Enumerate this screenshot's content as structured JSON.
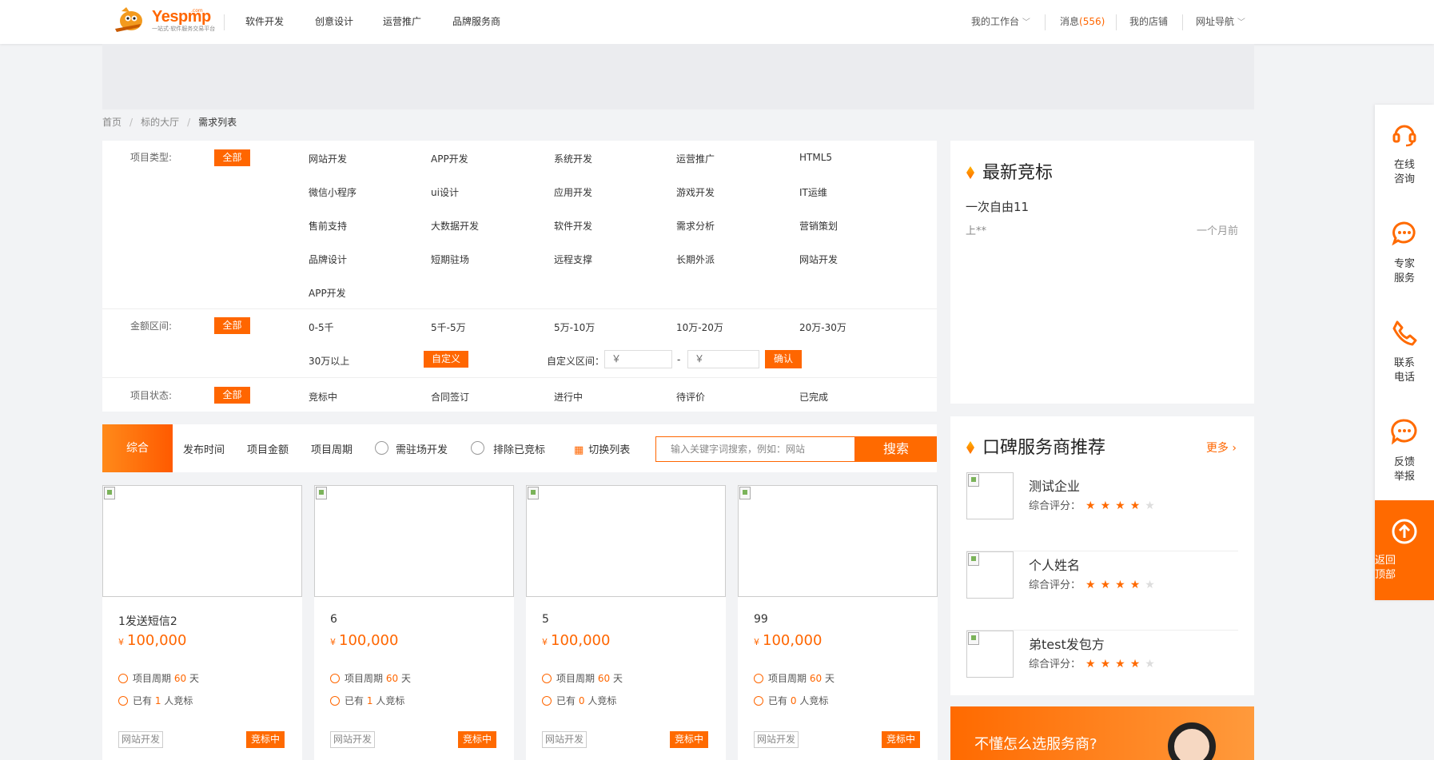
{
  "header": {
    "logo": "Yespmp",
    "logo_com": ".com",
    "logo_sub": "一站式·软件服务交易平台",
    "nav": [
      "软件开发",
      "创意设计",
      "运营推广",
      "品牌服务商"
    ],
    "right": {
      "workspace": "我的工作台",
      "messages_label": "消息",
      "messages_count": "(556)",
      "shop": "我的店铺",
      "sitemap": "网址导航"
    }
  },
  "breadcrumb": {
    "items": [
      "首页",
      "标的大厅",
      "需求列表"
    ],
    "sep": "/"
  },
  "filters": {
    "type_label": "项目类型:",
    "all": "全部",
    "types": [
      "网站开发",
      "APP开发",
      "系统开发",
      "运营推广",
      "HTML5",
      "微信小程序",
      "ui设计",
      "应用开发",
      "游戏开发",
      "IT运维",
      "售前支持",
      "大数据开发",
      "软件开发",
      "需求分析",
      "营销策划",
      "品牌设计",
      "短期驻场",
      "远程支撑",
      "长期外派",
      "网站开发",
      "APP开发"
    ],
    "amount_label": "金额区间:",
    "amounts": [
      "0-5千",
      "5千-5万",
      "5万-10万",
      "10万-20万",
      "20万-30万",
      "30万以上"
    ],
    "custom": "自定义",
    "custom_range": "自定义区间：",
    "from_ph": "￥",
    "to_ph": "￥",
    "dash": "-",
    "confirm": "确认",
    "status_label": "项目状态:",
    "statuses": [
      "竞标中",
      "合同签订",
      "进行中",
      "待评价",
      "已完成"
    ]
  },
  "sortbar": {
    "all": "综合",
    "items": [
      "发布时间",
      "项目金额",
      "项目周期"
    ],
    "onsite": "需驻场开发",
    "exclude": "排除已竞标",
    "toggle": "切换列表",
    "search_ph": "输入关键字词搜索，例如：网站",
    "search_btn": "搜索"
  },
  "cards": [
    {
      "title": "1发送短信2",
      "currency": "¥",
      "price": "100,000",
      "cycle_label": "项目周期",
      "cycle": "60",
      "unit": "天",
      "bid_pre": "已有",
      "bids": "1",
      "bid_post": "人竞标",
      "tag": "网站开发",
      "status": "竞标中"
    },
    {
      "title": "6",
      "currency": "¥",
      "price": "100,000",
      "cycle_label": "项目周期",
      "cycle": "60",
      "unit": "天",
      "bid_pre": "已有",
      "bids": "1",
      "bid_post": "人竞标",
      "tag": "网站开发",
      "status": "竞标中"
    },
    {
      "title": "5",
      "currency": "¥",
      "price": "100,000",
      "cycle_label": "项目周期",
      "cycle": "60",
      "unit": "天",
      "bid_pre": "已有",
      "bids": "0",
      "bid_post": "人竞标",
      "tag": "网站开发",
      "status": "竞标中"
    },
    {
      "title": "99",
      "currency": "¥",
      "price": "100,000",
      "cycle_label": "项目周期",
      "cycle": "60",
      "unit": "天",
      "bid_pre": "已有",
      "bids": "0",
      "bid_post": "人竞标",
      "tag": "网站开发",
      "status": "竞标中"
    }
  ],
  "latest": {
    "title": "最新竞标",
    "item_title": "一次自由11",
    "user": "上**",
    "time": "一个月前"
  },
  "providers": {
    "title": "口碑服务商推荐",
    "more": "更多",
    "rate_label": "综合评分：",
    "stars": 4,
    "items": [
      {
        "name": "测试企业"
      },
      {
        "name": "个人姓名"
      },
      {
        "name": "弟test发包方"
      }
    ]
  },
  "promo": {
    "text": "不懂怎么选服务商?"
  },
  "sidebar": [
    {
      "label": "在线\n咨询",
      "icon": "headset-icon"
    },
    {
      "label": "专家\n服务",
      "icon": "chat-headset-icon"
    },
    {
      "label": "联系\n电话",
      "icon": "phone-icon"
    },
    {
      "label": "反馈\n举报",
      "icon": "message-icon"
    },
    {
      "label": "返回\n顶部",
      "icon": "arrow-up-icon"
    }
  ],
  "colors": {
    "accent": "#ff6a00",
    "bg": "#f2f3f5"
  }
}
